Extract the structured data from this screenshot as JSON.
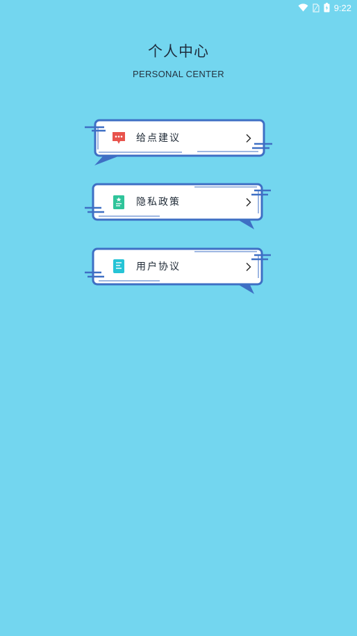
{
  "status_bar": {
    "time": "9:22",
    "icons": [
      "wifi-icon",
      "sim-icon",
      "battery-icon"
    ]
  },
  "header": {
    "title": "个人中心",
    "subtitle": "PERSONAL CENTER"
  },
  "menu": {
    "items": [
      {
        "label": "给点建议",
        "icon": "feedback-icon",
        "icon_color": "#e8534c"
      },
      {
        "label": "隐私政策",
        "icon": "privacy-icon",
        "icon_color": "#2fc49a"
      },
      {
        "label": "用户协议",
        "icon": "agreement-icon",
        "icon_color": "#26c4d6"
      }
    ]
  },
  "colors": {
    "background": "#73d6ef",
    "frame_stroke": "#3e6fc4",
    "card_fill": "#ffffff"
  }
}
